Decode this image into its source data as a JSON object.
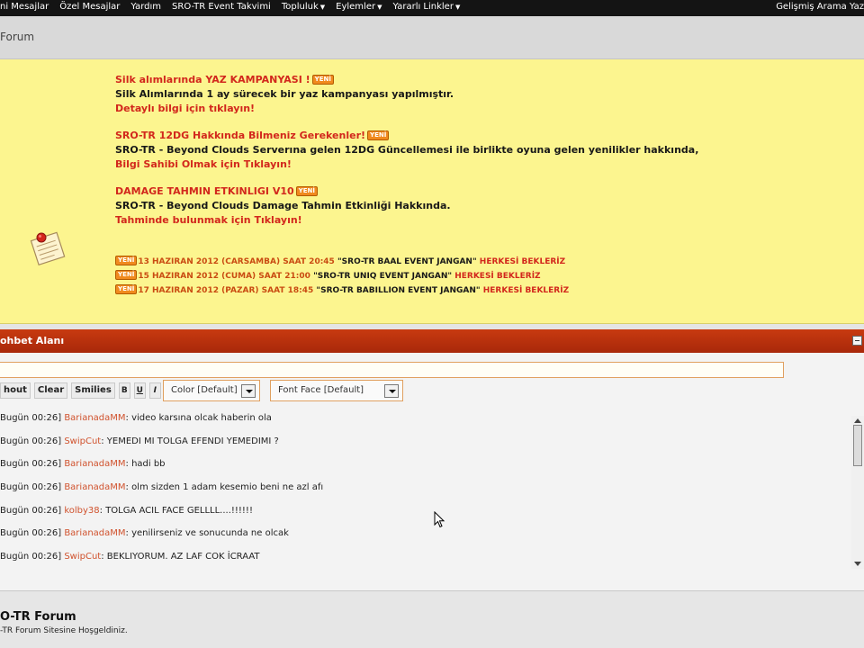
{
  "topnav": {
    "items": [
      {
        "label": "ni Mesajlar",
        "dropdown": false
      },
      {
        "label": "Özel Mesajlar",
        "dropdown": false
      },
      {
        "label": "Yardım",
        "dropdown": false
      },
      {
        "label": "SRO-TR Event Takvimi",
        "dropdown": false
      },
      {
        "label": "Topluluk",
        "dropdown": true
      },
      {
        "label": "Eylemler",
        "dropdown": true
      },
      {
        "label": "Yararlı Linkler",
        "dropdown": true
      }
    ],
    "right_label": "Gelişmiş Arama Yaz"
  },
  "breadcrumb": {
    "label": "Forum"
  },
  "notice": {
    "blocks": [
      {
        "title": "Silk alımlarında YAZ KAMPANYASI !",
        "body": "Silk Alımlarında 1 ay sürecek bir yaz kampanyası yapılmıştır.",
        "link": "Detaylı bilgi için tıklayın!"
      },
      {
        "title": "SRO-TR 12DG Hakkında Bilmeniz Gerekenler!",
        "body": "SRO-TR - Beyond Clouds Serverına gelen 12DG Güncellemesi ile birlikte oyuna gelen yenilikler hakkında,",
        "link": "Bilgi Sahibi Olmak için Tıklayın!"
      },
      {
        "title": "DAMAGE TAHMIN ETKINLIGI V10",
        "body": "SRO-TR - Beyond Clouds Damage Tahmin Etkinliği Hakkında.",
        "link": "Tahminde bulunmak için Tıklayın!"
      }
    ],
    "new_tag": "YENİ",
    "events": [
      {
        "date": "13 HAZIRAN 2012 (CARSAMBA) SAAT 20:45",
        "name": "\"SRO-TR BAAL EVENT JANGAN\"",
        "suffix": "HERKESİ BEKLERİZ"
      },
      {
        "date": "15 HAZIRAN 2012 (CUMA) SAAT 21:00",
        "name": "\"SRO-TR UNIQ EVENT JANGAN\"",
        "suffix": "HERKESİ BEKLERİZ"
      },
      {
        "date": "17 HAZIRAN 2012 (PAZAR) SAAT 18:45",
        "name": "\"SRO-TR BABILLION EVENT JANGAN\"",
        "suffix": "HERKESİ BEKLERİZ"
      }
    ]
  },
  "chat": {
    "header": "ohbet Alanı",
    "input_value": "",
    "toolbar": {
      "shout": "hout",
      "clear": "Clear",
      "smilies": "Smilies",
      "bold": "B",
      "underline": "U",
      "italic": "I",
      "color": "Color [Default]",
      "font_face": "Font Face [Default]"
    },
    "messages": [
      {
        "time": "Bugün 00:26]",
        "user": "BarianadaMM",
        "text": ": video karsına olcak haberin ola"
      },
      {
        "time": "Bugün 00:26]",
        "user": "SwipCut",
        "text": ": YEMEDI MI TOLGA EFENDI YEMEDIMI ?"
      },
      {
        "time": "Bugün 00:26]",
        "user": "BarianadaMM",
        "text": ": hadi bb"
      },
      {
        "time": "Bugün 00:26]",
        "user": "BarianadaMM",
        "text": ": olm sizden 1 adam kesemio beni ne azl afı"
      },
      {
        "time": "Bugün 00:26]",
        "user": "kolby38",
        "text": ": TOLGA ACIL FACE GELLLL....!!!!!!"
      },
      {
        "time": "Bugün 00:26]",
        "user": "BarianadaMM",
        "text": ": yenilirseniz ve sonucunda ne olcak"
      },
      {
        "time": "Bugün 00:26]",
        "user": "SwipCut",
        "text": ": BEKLIYORUM. AZ LAF COK İCRAAT"
      }
    ]
  },
  "footer": {
    "title": "O-TR Forum",
    "subtitle": "-TR Forum Sitesine Hoşgeldiniz."
  }
}
